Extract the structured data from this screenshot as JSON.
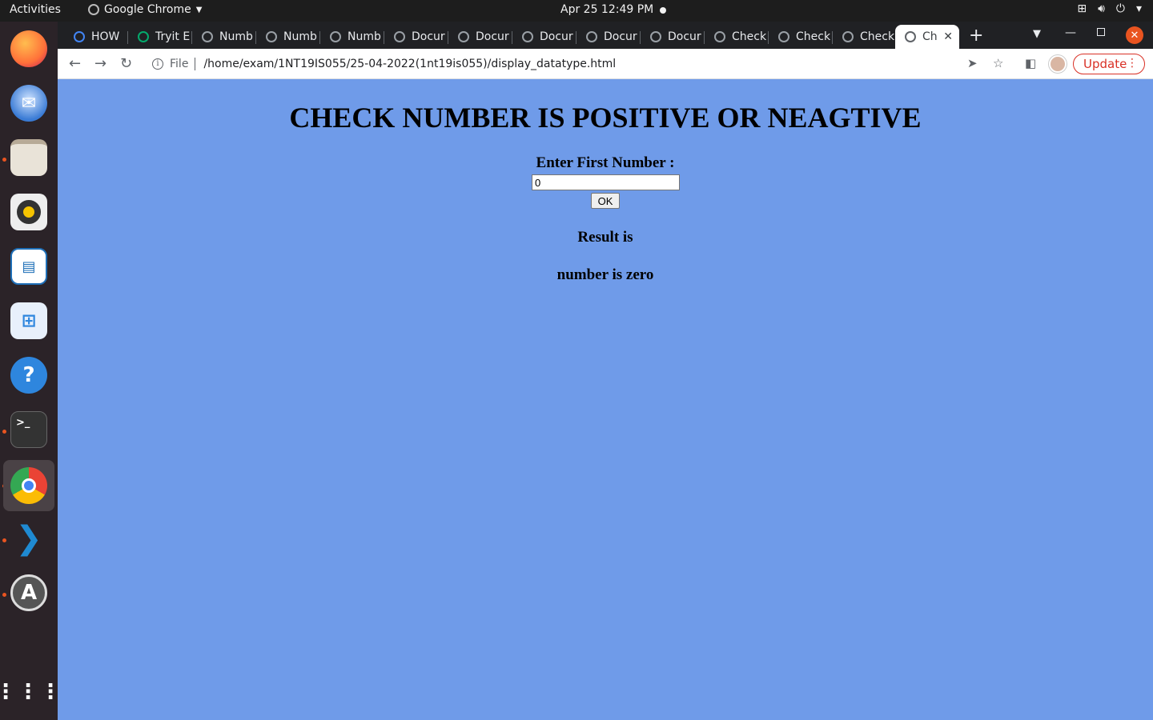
{
  "topbar": {
    "activities": "Activities",
    "app_name": "Google Chrome",
    "clock": "Apr 25  12:49 PM"
  },
  "dock": {
    "items": [
      {
        "name": "firefox",
        "color": "#ff7139"
      },
      {
        "name": "thunderbird",
        "color": "#3a7bd5"
      },
      {
        "name": "files",
        "color": "#e9e3d8"
      },
      {
        "name": "rhythmbox",
        "color": "#f5c400"
      },
      {
        "name": "libreoffice-writer",
        "color": "#1e6fb7"
      },
      {
        "name": "software-center",
        "color": "#4a90d9"
      },
      {
        "name": "help",
        "color": "#2e86de"
      },
      {
        "name": "terminal",
        "color": "#333333"
      },
      {
        "name": "chrome",
        "color": "#4285f4"
      },
      {
        "name": "vscode",
        "color": "#1f8ad2"
      },
      {
        "name": "software-updater",
        "color": "#555555"
      },
      {
        "name": "show-applications",
        "color": "#ffffff"
      }
    ]
  },
  "browser": {
    "tabs": [
      {
        "label": "HOW"
      },
      {
        "label": "Tryit E"
      },
      {
        "label": "Numb"
      },
      {
        "label": "Numb"
      },
      {
        "label": "Numb"
      },
      {
        "label": "Docur"
      },
      {
        "label": "Docur"
      },
      {
        "label": "Docur"
      },
      {
        "label": "Docur"
      },
      {
        "label": "Docur"
      },
      {
        "label": "Check"
      },
      {
        "label": "Check"
      },
      {
        "label": "Check"
      },
      {
        "label": "Ch"
      }
    ],
    "omnibox": {
      "scheme": "File",
      "url": "/home/exam/1NT19IS055/25-04-2022(1nt19is055)/display_datatype.html"
    },
    "update_label": "Update",
    "accent_color": "#d93025"
  },
  "page": {
    "background": "#6f9be9",
    "title": "CHECK NUMBER IS POSITIVE OR NEAGTIVE",
    "field_label": "Enter First Number :",
    "input_value": "0",
    "ok_label": "OK",
    "result_label": "Result is",
    "result_value": "number is zero"
  }
}
